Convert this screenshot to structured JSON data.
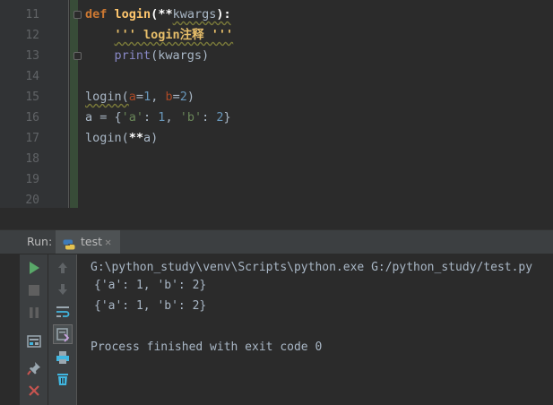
{
  "editor": {
    "line_numbers": [
      "11",
      "12",
      "13",
      "14",
      "15",
      "16",
      "17",
      "18",
      "19",
      "20"
    ],
    "code": {
      "l11_kw": "def",
      "l11_fn": "login",
      "l11_open": "(",
      "l11_op": "**",
      "l11_param": "kwargs",
      "l11_close": "):",
      "l12_doc": "''' login注释 '''",
      "l13_builtin": "print",
      "l13_rest": "(kwargs)",
      "l15_call": "login(",
      "l15_a": "a",
      "l15_eq1": "=",
      "l15_one": "1",
      "l15_comma": ", ",
      "l15_b": "b",
      "l15_eq2": "=",
      "l15_two": "2",
      "l15_close": ")",
      "l16_lhs": "a = {",
      "l16_ka": "'a'",
      "l16_colon1": ": ",
      "l16_va": "1",
      "l16_comma": ", ",
      "l16_kb": "'b'",
      "l16_colon2": ": ",
      "l16_vb": "2",
      "l16_close": "}",
      "l17_call": "login(",
      "l17_op": "**",
      "l17_arg": "a)"
    }
  },
  "run": {
    "label": "Run:",
    "tab_label": "test",
    "tab_close": "✕",
    "console_lines": [
      "G:\\python_study\\venv\\Scripts\\python.exe G:/python_study/test.py",
      "{'a': 1, 'b': 2}",
      "{'a': 1, 'b': 2}",
      "",
      "Process finished with exit code 0"
    ],
    "toolbar_icons": [
      "run-icon",
      "stop-icon",
      "pause-icon",
      "layout-icon",
      "pin-icon",
      "close-icon",
      "up-arrow-icon",
      "down-arrow-icon",
      "soft-wrap-icon",
      "scroll-to-end-icon",
      "print-icon",
      "trash-icon"
    ]
  },
  "colors": {
    "editor_bg": "#2b2b2b",
    "gutter_bg": "#313335",
    "panel_bg": "#3c3f41",
    "keyword": "#cc7832",
    "function": "#ffc66d",
    "string": "#6a8759",
    "number": "#6897bb",
    "builtin": "#8888c6"
  }
}
